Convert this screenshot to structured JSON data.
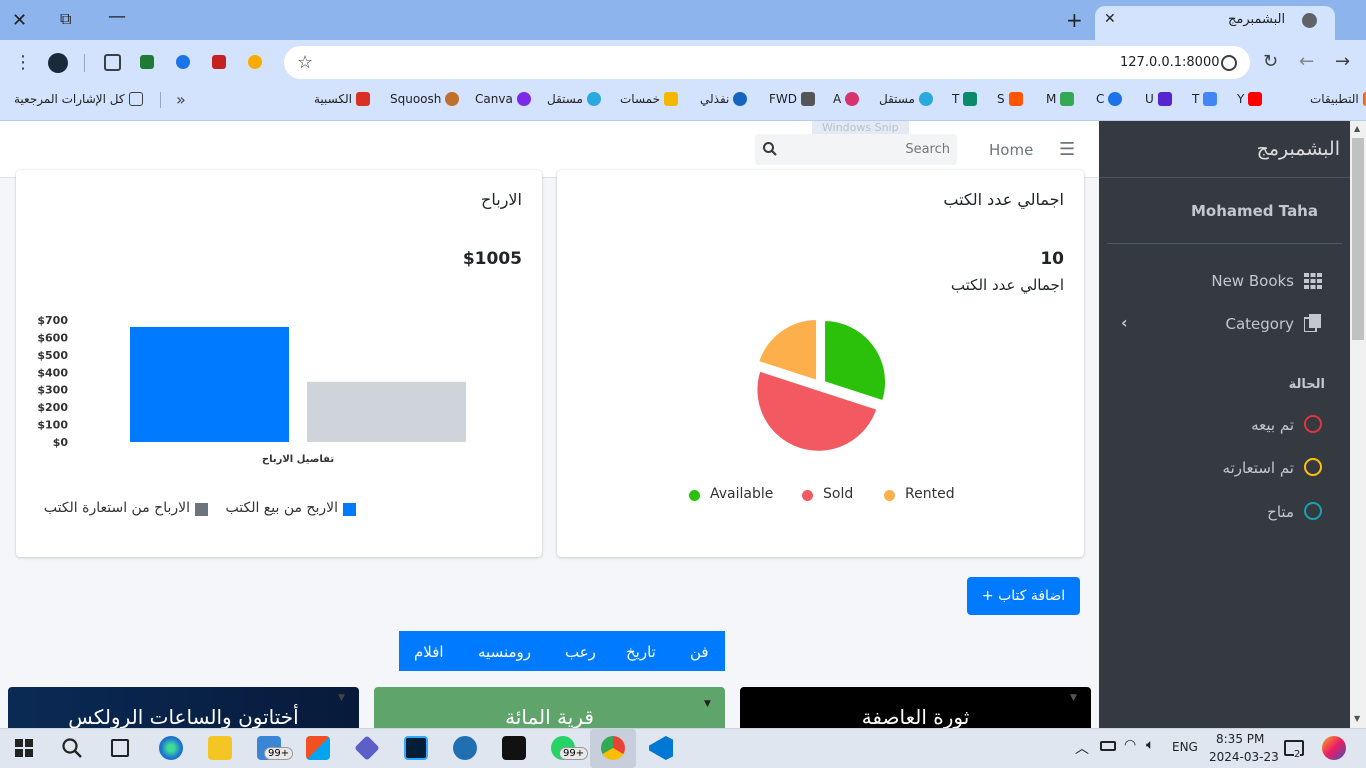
{
  "browser": {
    "tab_title": "البشمبرمج",
    "url": "127.0.0.1:8000",
    "bookmarks": [
      "التطبيقات",
      "Y",
      "T",
      "U",
      "C",
      "M",
      "S",
      "T",
      "مستقل",
      "A",
      "FWD",
      "نفذلي",
      "خمسات",
      "مستقل",
      "Canva",
      "Squoosh",
      "الكسبية"
    ],
    "all_bookmarks": "كل الإشارات المرجعية",
    "snip": "Windows Snip"
  },
  "navbar": {
    "home": "Home",
    "search_placeholder": "Search"
  },
  "sidebar": {
    "brand": "البشمبرمج",
    "user": "Mohamed Taha",
    "menu": [
      {
        "label": "New Books"
      },
      {
        "label": "Category"
      }
    ],
    "status_header": "الحالة",
    "statuses": [
      {
        "label": "تم بيعه",
        "color": "#dc3545"
      },
      {
        "label": "تم استعارته",
        "color": "#ffc107"
      },
      {
        "label": "متاح",
        "color": "#17a2b8"
      }
    ]
  },
  "books_card": {
    "title": "اجمالي عدد الكتب",
    "count": "10",
    "count_label": "اجمالي عدد الكتب"
  },
  "profit_card": {
    "title": "الارباح",
    "total": "$1005"
  },
  "chart_data": [
    {
      "type": "pie",
      "labels": [
        "Available",
        "Sold",
        "Rented"
      ],
      "values": [
        3,
        5,
        2
      ],
      "colors": [
        "#2bc10b",
        "#f25961",
        "#fdaf4b"
      ],
      "legend": "bottom"
    },
    {
      "type": "bar",
      "categories": [
        "تفاصيل الارباح"
      ],
      "series": [
        {
          "name": "الاربح من بيع الكتب",
          "values": [
            660
          ],
          "color": "#007bff"
        },
        {
          "name": "الارباح من استعارة الكتب",
          "values": [
            345
          ],
          "color": "#ced4da"
        }
      ],
      "yticks": [
        "$0",
        "$100",
        "$200",
        "$300",
        "$400",
        "$500",
        "$600",
        "$700"
      ],
      "ylim": [
        0,
        700
      ],
      "legend_colors": [
        "#007bff",
        "#6c757d"
      ]
    }
  ],
  "actions": {
    "add_book": "+ اضافة كتاب"
  },
  "categories": [
    "فن",
    "تاريخ",
    "رعب",
    "رومنسيه",
    "افلام"
  ],
  "books": [
    {
      "title": "ثورة العاصفة",
      "bg": "#000000"
    },
    {
      "title": "قرية المائة",
      "bg": "#5fa46a"
    },
    {
      "title": "أختاتون والساعات الرولكس",
      "bg": "#071a3a"
    }
  ],
  "taskbar": {
    "badge1": "99+",
    "badge2": "99+",
    "lang": "ENG",
    "time": "8:35 PM",
    "date": "2024-03-23",
    "notif": "2"
  }
}
